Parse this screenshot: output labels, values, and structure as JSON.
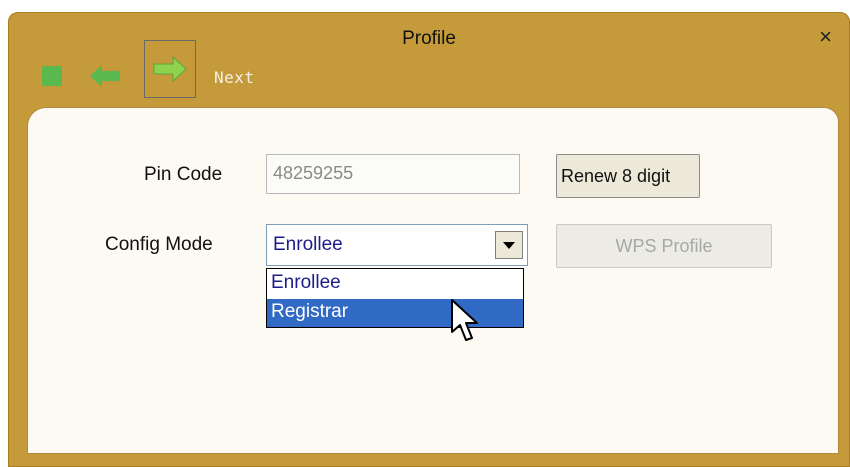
{
  "window": {
    "title": "Profile",
    "close_glyph": "×"
  },
  "toolbar": {
    "stop_icon": "stop-square-icon",
    "back_icon": "back-arrow-icon",
    "next_icon": "next-arrow-icon",
    "next_label": "Next"
  },
  "form": {
    "pin_code_label": "Pin Code",
    "pin_code_value": "48259255",
    "config_mode_label": "Config Mode",
    "config_mode_value": "Enrollee",
    "options": [
      "Enrollee",
      "Registrar"
    ],
    "highlighted_option": "Registrar"
  },
  "buttons": {
    "renew_label": "Renew 8 digit",
    "wps_profile_label": "WPS Profile"
  },
  "colors": {
    "frame": "#c49a3a",
    "panel": "#fcfaf2",
    "icon_green": "#59b94e",
    "selection": "#316ac5",
    "select_text": "#1d1d8a"
  }
}
